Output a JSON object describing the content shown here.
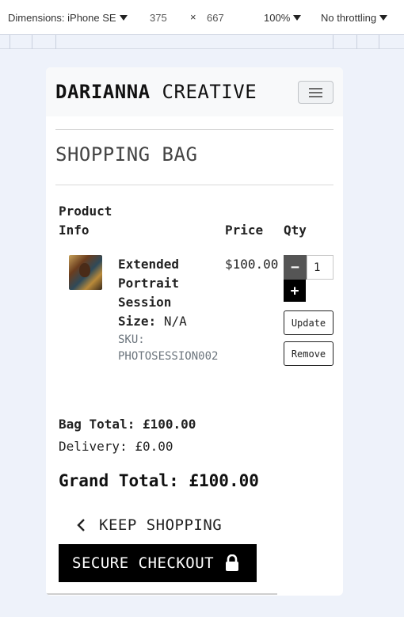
{
  "devtools": {
    "dimensions_label": "Dimensions: iPhone SE",
    "width": "375",
    "times": "×",
    "height": "667",
    "zoom": "100%",
    "throttling": "No throttling"
  },
  "navbar": {
    "brand_bold": "DARIANNA",
    "brand_light": "CREATIVE",
    "toggler_icon": "hamburger-icon"
  },
  "page": {
    "title": "SHOPPING BAG"
  },
  "table": {
    "headers": {
      "product_info_1": "Product",
      "product_info_2": "Info",
      "price": "Price",
      "qty": "Qty"
    }
  },
  "item": {
    "name_lines": [
      "Extended",
      "Portrait",
      "Session"
    ],
    "size_label": "Size:",
    "size_value": "N/A",
    "sku_label": "SKU:",
    "sku_value": "PHOTOSESSION002",
    "price": "$100.00",
    "qty": "1",
    "minus_label": "−",
    "plus_label": "+",
    "update_label": "Update",
    "remove_label": "Remove"
  },
  "totals": {
    "bag_label": "Bag Total:",
    "bag_value": "£100.00",
    "delivery_label": "Delivery:",
    "delivery_value": "£0.00",
    "grand_label": "Grand Total:",
    "grand_value": "£100.00"
  },
  "actions": {
    "keep_shopping": "KEEP SHOPPING",
    "checkout": "SECURE CHECKOUT"
  }
}
